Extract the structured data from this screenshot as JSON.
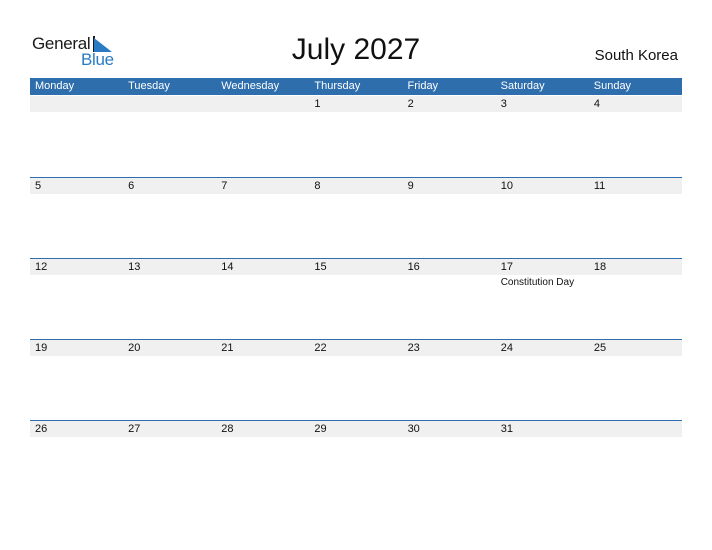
{
  "logo": {
    "line1": "General",
    "line2": "Blue",
    "accent_color": "#2a7bc4"
  },
  "title": "July 2027",
  "country": "South Korea",
  "colors": {
    "header_bg": "#2e6ead",
    "date_strip_bg": "#f0f0f0"
  },
  "weekdays": [
    "Monday",
    "Tuesday",
    "Wednesday",
    "Thursday",
    "Friday",
    "Saturday",
    "Sunday"
  ],
  "weeks": [
    {
      "days": [
        {
          "date": ""
        },
        {
          "date": ""
        },
        {
          "date": ""
        },
        {
          "date": "1"
        },
        {
          "date": "2"
        },
        {
          "date": "3"
        },
        {
          "date": "4"
        }
      ]
    },
    {
      "days": [
        {
          "date": "5"
        },
        {
          "date": "6"
        },
        {
          "date": "7"
        },
        {
          "date": "8"
        },
        {
          "date": "9"
        },
        {
          "date": "10"
        },
        {
          "date": "11"
        }
      ]
    },
    {
      "days": [
        {
          "date": "12"
        },
        {
          "date": "13"
        },
        {
          "date": "14"
        },
        {
          "date": "15"
        },
        {
          "date": "16"
        },
        {
          "date": "17",
          "event": "Constitution Day"
        },
        {
          "date": "18"
        }
      ]
    },
    {
      "days": [
        {
          "date": "19"
        },
        {
          "date": "20"
        },
        {
          "date": "21"
        },
        {
          "date": "22"
        },
        {
          "date": "23"
        },
        {
          "date": "24"
        },
        {
          "date": "25"
        }
      ]
    },
    {
      "days": [
        {
          "date": "26"
        },
        {
          "date": "27"
        },
        {
          "date": "28"
        },
        {
          "date": "29"
        },
        {
          "date": "30"
        },
        {
          "date": "31"
        },
        {
          "date": ""
        }
      ]
    }
  ]
}
